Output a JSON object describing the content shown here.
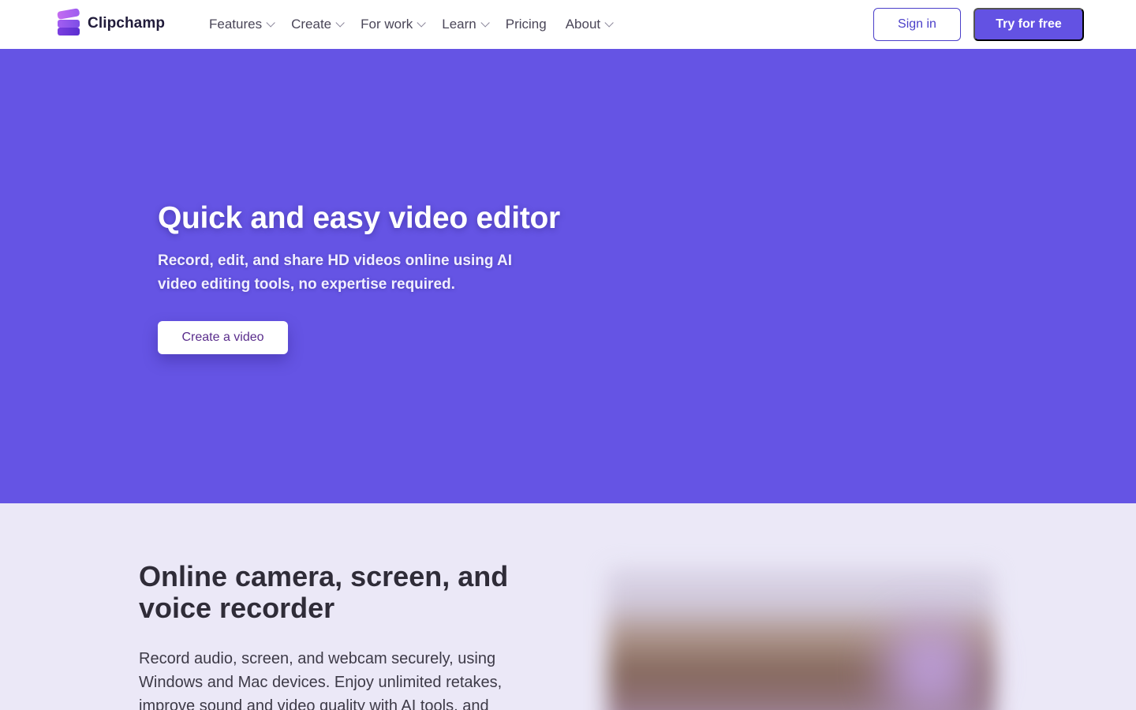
{
  "nav": {
    "brand": "Clipchamp",
    "items": [
      {
        "label": "Features",
        "has_dropdown": true
      },
      {
        "label": "Create",
        "has_dropdown": true
      },
      {
        "label": "For work",
        "has_dropdown": true
      },
      {
        "label": "Learn",
        "has_dropdown": true
      },
      {
        "label": "Pricing",
        "has_dropdown": false
      },
      {
        "label": "About",
        "has_dropdown": true
      }
    ],
    "signin_label": "Sign in",
    "tryfree_label": "Try for free"
  },
  "hero": {
    "title": "Quick and easy video editor",
    "subtitle": "Record, edit, and share HD videos online using AI video editing tools, no expertise required.",
    "cta_label": "Create a video",
    "background_color": "#6554e4"
  },
  "section2": {
    "title": "Online camera, screen, and voice recorder",
    "body": "Record audio, screen, and webcam securely, using Windows and Mac devices. Enjoy unlimited retakes, improve sound and video quality with AI tools, and"
  },
  "colors": {
    "accent": "#6352e3",
    "hero_bg": "#6554e4",
    "section_bg": "#ebe8f7"
  },
  "icons": {
    "brand_logo": "clipchamp-logo-icon",
    "dropdown": "chevron-down-icon"
  }
}
